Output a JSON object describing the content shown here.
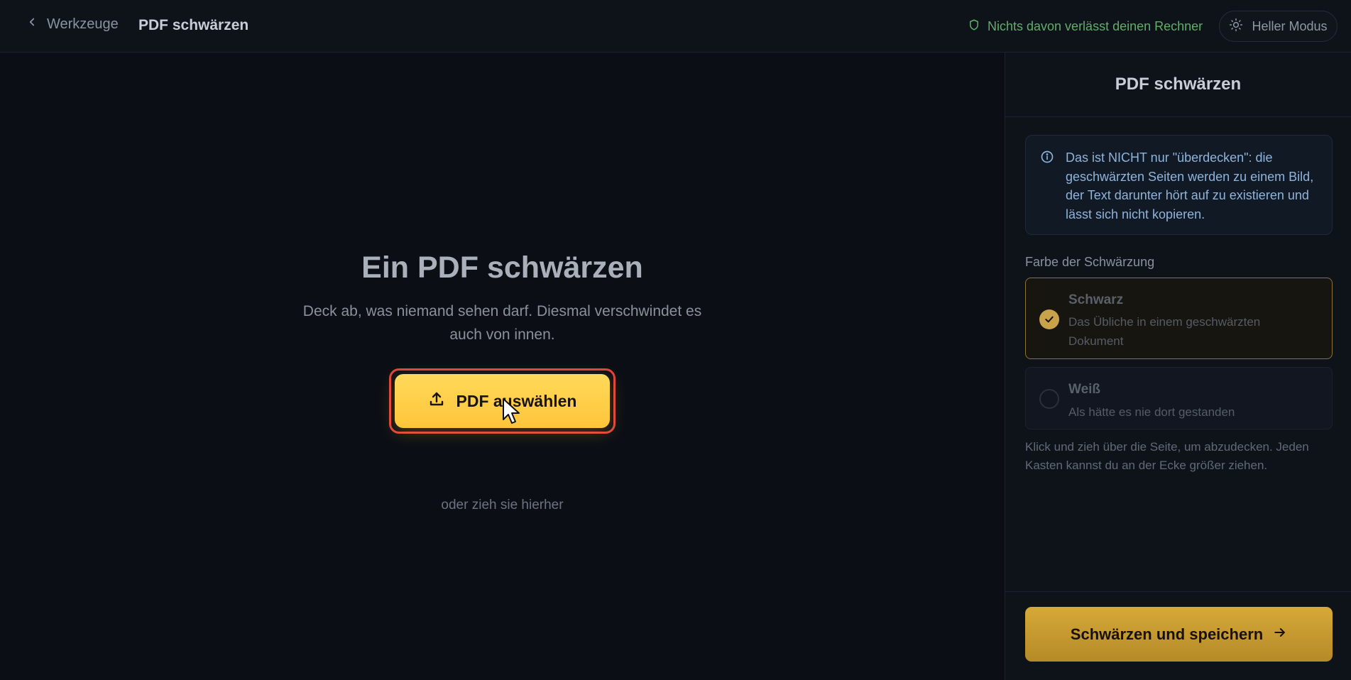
{
  "topbar": {
    "back_label": "Werkzeuge",
    "title": "PDF schwärzen",
    "privacy_note": "Nichts davon verlässt deinen Rechner",
    "theme_toggle_label": "Heller Modus"
  },
  "main": {
    "title": "Ein PDF schwärzen",
    "subtitle": "Deck ab, was niemand sehen darf. Diesmal verschwindet es auch von innen.",
    "upload_button_label": "PDF auswählen",
    "drop_hint": "oder zieh sie hierher"
  },
  "panel": {
    "title": "PDF schwärzen",
    "info_text": "Das ist NICHT nur \"überdecken\": die geschwärzten Seiten werden zu einem Bild, der Text darunter hört auf zu existieren und lässt sich nicht kopieren.",
    "color_section_label": "Farbe der Schwärzung",
    "options": [
      {
        "title": "Schwarz",
        "description": "Das Übliche in einem geschwärzten Dokument",
        "selected": true
      },
      {
        "title": "Weiß",
        "description": "Als hätte es nie dort gestanden",
        "selected": false
      }
    ],
    "hint": "Klick und zieh über die Seite, um abzudecken. Jeden Kasten kannst du an der Ecke größer ziehen.",
    "save_button_label": "Schwärzen und speichern"
  },
  "colors": {
    "accent": "#ffc53a",
    "save_accent": "#c99a30",
    "privacy_green": "#5fae6a",
    "info_blue": "#8eb4dc",
    "focus_ring": "#e0433b"
  },
  "icons": {
    "back": "chevron-left-icon",
    "privacy": "shield-icon",
    "theme": "sun-icon",
    "upload": "upload-icon",
    "info": "info-icon",
    "check": "check-icon",
    "save": "arrow-right-icon",
    "cursor": "mouse-pointer-icon"
  }
}
